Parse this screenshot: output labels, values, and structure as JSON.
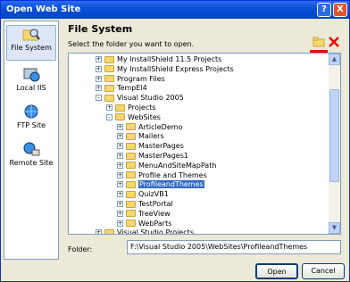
{
  "window": {
    "title": "Open Web Site",
    "help_label": "?",
    "close_label": "X"
  },
  "nav": [
    {
      "label": "File System",
      "icon": "folder-search-icon",
      "selected": true
    },
    {
      "label": "Local IIS",
      "icon": "globe-icon"
    },
    {
      "label": "FTP Site",
      "icon": "ftp-icon"
    },
    {
      "label": "Remote Site",
      "icon": "remote-site-icon"
    }
  ],
  "heading": "File System",
  "instruction": "Select the folder you want to open.",
  "tree": [
    {
      "label": "My InstallShield 11.5 Projects",
      "indent": 0,
      "expand": "+"
    },
    {
      "label": "My InstallShield Express Projects",
      "indent": 0,
      "expand": "+"
    },
    {
      "label": "Program Files",
      "indent": 0,
      "expand": "+"
    },
    {
      "label": "TempEl4",
      "indent": 0,
      "expand": "+"
    },
    {
      "label": "Visual Studio 2005",
      "indent": 0,
      "expand": "-"
    },
    {
      "label": "Projects",
      "indent": 1,
      "expand": "+"
    },
    {
      "label": "WebSites",
      "indent": 1,
      "expand": "-"
    },
    {
      "label": "ArticleDemo",
      "indent": 2,
      "expand": "+"
    },
    {
      "label": "Mailers",
      "indent": 2,
      "expand": "+"
    },
    {
      "label": "MasterPages",
      "indent": 2,
      "expand": "+"
    },
    {
      "label": "MasterPages1",
      "indent": 2,
      "expand": "+"
    },
    {
      "label": "MenuAndSiteMapPath",
      "indent": 2,
      "expand": "+"
    },
    {
      "label": "Profile and Themes",
      "indent": 2,
      "expand": "+"
    },
    {
      "label": "ProfileandThemes",
      "indent": 2,
      "expand": "+",
      "selected": true
    },
    {
      "label": "QuizVB1",
      "indent": 2,
      "expand": "+"
    },
    {
      "label": "TestPortal",
      "indent": 2,
      "expand": "+"
    },
    {
      "label": "TreeView",
      "indent": 2,
      "expand": "+"
    },
    {
      "label": "WebParts",
      "indent": 2,
      "expand": "+"
    },
    {
      "label": "Visual Studio Projects",
      "indent": 0,
      "expand": "+"
    }
  ],
  "folder": {
    "label": "Folder:",
    "value": "F:\\Visual Studio 2005\\WebSites\\ProfileandThemes"
  },
  "buttons": {
    "open": "Open",
    "cancel": "Cancel"
  }
}
